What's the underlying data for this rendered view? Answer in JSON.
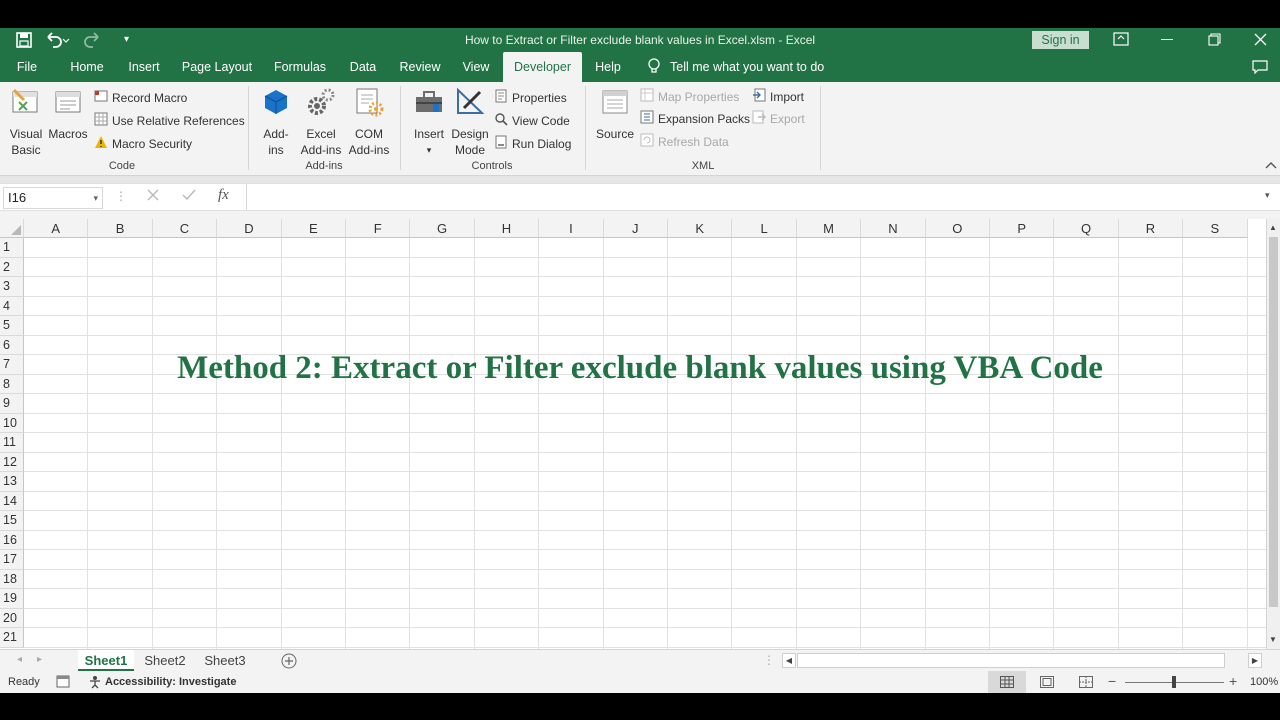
{
  "window": {
    "title": "How to Extract or Filter exclude blank values in Excel.xlsm  -  Excel",
    "sign_in": "Sign in"
  },
  "tabs": [
    "File",
    "Home",
    "Insert",
    "Page Layout",
    "Formulas",
    "Data",
    "Review",
    "View",
    "Developer",
    "Help"
  ],
  "active_tab": "Developer",
  "tell_me": "Tell me what you want to do",
  "ribbon": {
    "code": {
      "label": "Code",
      "visual_basic": [
        "Visual",
        "Basic"
      ],
      "macros": "Macros",
      "record_macro": "Record Macro",
      "use_relative": "Use Relative References",
      "macro_security": "Macro Security"
    },
    "addins": {
      "label": "Add-ins",
      "addins": [
        "Add-",
        "ins"
      ],
      "excel_addins": [
        "Excel",
        "Add-ins"
      ],
      "com_addins": [
        "COM",
        "Add-ins"
      ]
    },
    "controls": {
      "label": "Controls",
      "insert": "Insert",
      "design_mode": [
        "Design",
        "Mode"
      ],
      "properties": "Properties",
      "view_code": "View Code",
      "run_dialog": "Run Dialog"
    },
    "xml": {
      "label": "XML",
      "source": "Source",
      "map_properties": "Map Properties",
      "expansion_packs": "Expansion Packs",
      "refresh_data": "Refresh Data",
      "import": "Import",
      "export": "Export"
    }
  },
  "formula_bar": {
    "name_box": "I16",
    "fx": "fx",
    "formula": ""
  },
  "columns": [
    "A",
    "B",
    "C",
    "D",
    "E",
    "F",
    "G",
    "H",
    "I",
    "J",
    "K",
    "L",
    "M",
    "N",
    "O",
    "P",
    "Q",
    "R",
    "S"
  ],
  "rows": [
    "1",
    "2",
    "3",
    "4",
    "5",
    "6",
    "7",
    "8",
    "9",
    "10",
    "11",
    "12",
    "13",
    "14",
    "15",
    "16",
    "17",
    "18",
    "19",
    "20",
    "21"
  ],
  "heading": "Method 2: Extract or Filter exclude blank values using VBA Code",
  "sheets": [
    "Sheet1",
    "Sheet2",
    "Sheet3"
  ],
  "active_sheet": "Sheet1",
  "status": {
    "ready": "Ready",
    "accessibility": "Accessibility: Investigate",
    "zoom": "100%"
  },
  "colors": {
    "brand": "#217346",
    "heading": "#217346"
  }
}
